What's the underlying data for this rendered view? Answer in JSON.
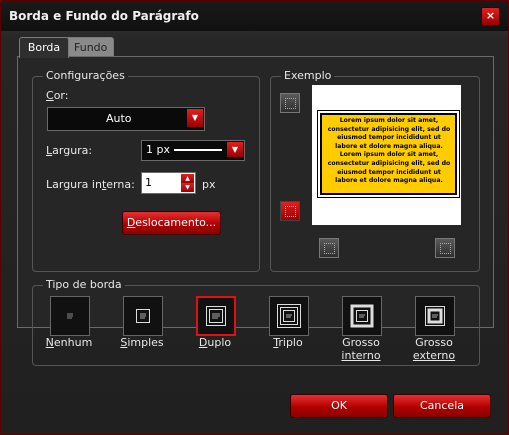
{
  "window": {
    "title": "Borda e Fundo do Parágrafo",
    "close_icon": "×"
  },
  "tabs": [
    {
      "label": "Borda",
      "active": true
    },
    {
      "label": "Fundo",
      "active": false
    }
  ],
  "settings": {
    "group_label": "Configurações",
    "color": {
      "label": "Cor:",
      "value": "Auto"
    },
    "width": {
      "label": "Largura:",
      "value": "1 px"
    },
    "inner_width": {
      "label": "Largura interna:",
      "value": "1",
      "unit": "px"
    },
    "offset_button": "Deslocamento..."
  },
  "example": {
    "group_label": "Exemplo",
    "text": "Lorem ipsum dolor sit amet, consectetur adipisicing elit, sed do eiusmod tempor incididunt ut labore et dolore magna aliqua. Lorem ipsum dolor sit amet, consectetur adipisicing elit, sed do eiusmod tempor incididunt ut labore et dolore magna aliqua.",
    "fill_color": "#ffcc00"
  },
  "border_type": {
    "group_label": "Tipo de borda",
    "options": [
      {
        "label": "Nenhum",
        "selected": false
      },
      {
        "label": "Simples",
        "selected": false
      },
      {
        "label": "Duplo",
        "selected": true
      },
      {
        "label": "Triplo",
        "selected": false
      },
      {
        "label": "Grosso interno",
        "label1": "Grosso",
        "label2": "interno",
        "selected": false
      },
      {
        "label": "Grosso externo",
        "label1": "Grosso",
        "label2": "externo",
        "selected": false
      }
    ]
  },
  "footer": {
    "ok": "OK",
    "cancel": "Cancela"
  },
  "colors": {
    "accent": "#c00000",
    "background": "#262626"
  }
}
